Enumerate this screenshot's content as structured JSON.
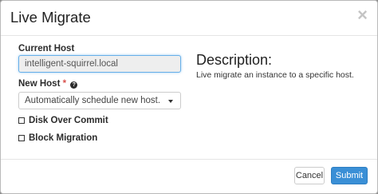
{
  "dialog": {
    "title": "Live Migrate",
    "close_glyph": "×"
  },
  "form": {
    "current_host_label": "Current Host",
    "current_host_value": "intelligent-squirrel.local",
    "new_host_label": "New Host",
    "required_marker": "*",
    "help_glyph": "?",
    "new_host_selected": "Automatically schedule new host.",
    "disk_over_commit_label": "Disk Over Commit",
    "disk_over_commit_checked": false,
    "block_migration_label": "Block Migration",
    "block_migration_checked": false
  },
  "description": {
    "heading": "Description:",
    "text": "Live migrate an instance to a specific host."
  },
  "footer": {
    "cancel_label": "Cancel",
    "submit_label": "Submit"
  },
  "colors": {
    "primary": "#3a8fd6",
    "required": "#d9534f",
    "focus_border": "#66afe9"
  }
}
